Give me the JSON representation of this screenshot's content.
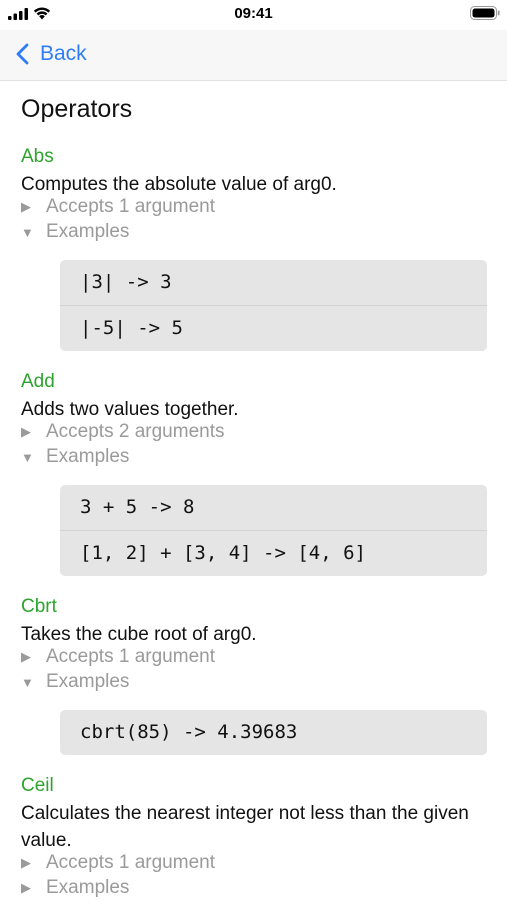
{
  "status_bar": {
    "time": "09:41",
    "icons": [
      "signal-bars-icon",
      "wifi-icon",
      "battery-icon"
    ]
  },
  "nav": {
    "back_label": "Back",
    "back_icon": "chevron-left-icon",
    "accent_color": "#2f7df6"
  },
  "page": {
    "title": "Operators"
  },
  "colors": {
    "operator_name": "#2da42d",
    "secondary_text": "#9a9a9a",
    "example_background": "#e5e5e5"
  },
  "operators": [
    {
      "name": "Abs",
      "description": "Computes the absolute value of arg0.",
      "accepts_label": "Accepts 1 argument",
      "accepts_expanded": false,
      "examples_label": "Examples",
      "examples_expanded": true,
      "examples": [
        "|3| -> 3",
        "|-5| -> 5"
      ]
    },
    {
      "name": "Add",
      "description": "Adds two values together.",
      "accepts_label": "Accepts 2 arguments",
      "accepts_expanded": false,
      "examples_label": "Examples",
      "examples_expanded": true,
      "examples": [
        "3 + 5 -> 8",
        "[1, 2] + [3, 4] -> [4, 6]"
      ]
    },
    {
      "name": "Cbrt",
      "description": "Takes the cube root of arg0.",
      "accepts_label": "Accepts 1 argument",
      "accepts_expanded": false,
      "examples_label": "Examples",
      "examples_expanded": true,
      "examples": [
        "cbrt(85) -> 4.39683"
      ]
    },
    {
      "name": "Ceil",
      "description": "Calculates the nearest integer not less than the given value.",
      "accepts_label": "Accepts 1 argument",
      "accepts_expanded": false,
      "examples_label": "Examples",
      "examples_expanded": false,
      "examples": []
    }
  ]
}
